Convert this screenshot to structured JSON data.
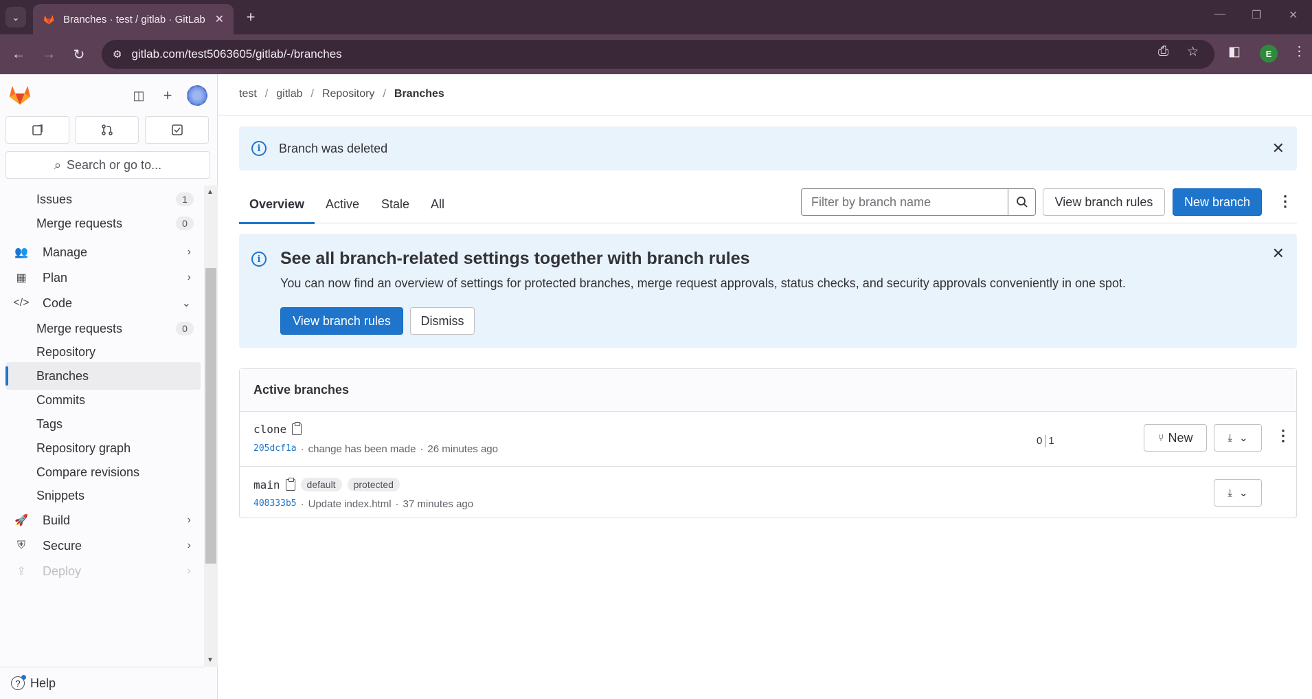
{
  "browser": {
    "tab_title": "Branches · test / gitlab · GitLab",
    "url": "gitlab.com/test5063605/gitlab/-/branches",
    "profile_initial": "E"
  },
  "sidebar": {
    "search_placeholder": "Search or go to...",
    "items": [
      {
        "label": "Issues",
        "count": "1"
      },
      {
        "label": "Merge requests",
        "count": "0"
      },
      {
        "label": "Manage"
      },
      {
        "label": "Plan"
      },
      {
        "label": "Code"
      },
      {
        "label": "Merge requests",
        "count": "0"
      },
      {
        "label": "Repository"
      },
      {
        "label": "Branches"
      },
      {
        "label": "Commits"
      },
      {
        "label": "Tags"
      },
      {
        "label": "Repository graph"
      },
      {
        "label": "Compare revisions"
      },
      {
        "label": "Snippets"
      },
      {
        "label": "Build"
      },
      {
        "label": "Secure"
      },
      {
        "label": "Deploy"
      }
    ],
    "help_label": "Help"
  },
  "breadcrumb": [
    "test",
    "gitlab",
    "Repository",
    "Branches"
  ],
  "alert": {
    "message": "Branch was deleted"
  },
  "tabs": [
    "Overview",
    "Active",
    "Stale",
    "All"
  ],
  "filter": {
    "placeholder": "Filter by branch name"
  },
  "actions": {
    "view_rules": "View branch rules",
    "new_branch": "New branch"
  },
  "promo": {
    "title": "See all branch-related settings together with branch rules",
    "body": "You can now find an overview of settings for protected branches, merge request approvals, status checks, and security approvals conveniently in one spot.",
    "primary": "View branch rules",
    "secondary": "Dismiss"
  },
  "active_branches": {
    "title": "Active branches",
    "rows": [
      {
        "name": "clone",
        "sha": "205dcf1a",
        "message": "change has been made",
        "time": "26 minutes ago",
        "behind": "0",
        "ahead": "1",
        "new_label": "New"
      },
      {
        "name": "main",
        "sha": "408333b5",
        "message": "Update index.html",
        "time": "37 minutes ago",
        "badges": [
          "default",
          "protected"
        ]
      }
    ]
  },
  "colors": {
    "accent": "#1f75cb",
    "chrome": "#5a3f55"
  }
}
